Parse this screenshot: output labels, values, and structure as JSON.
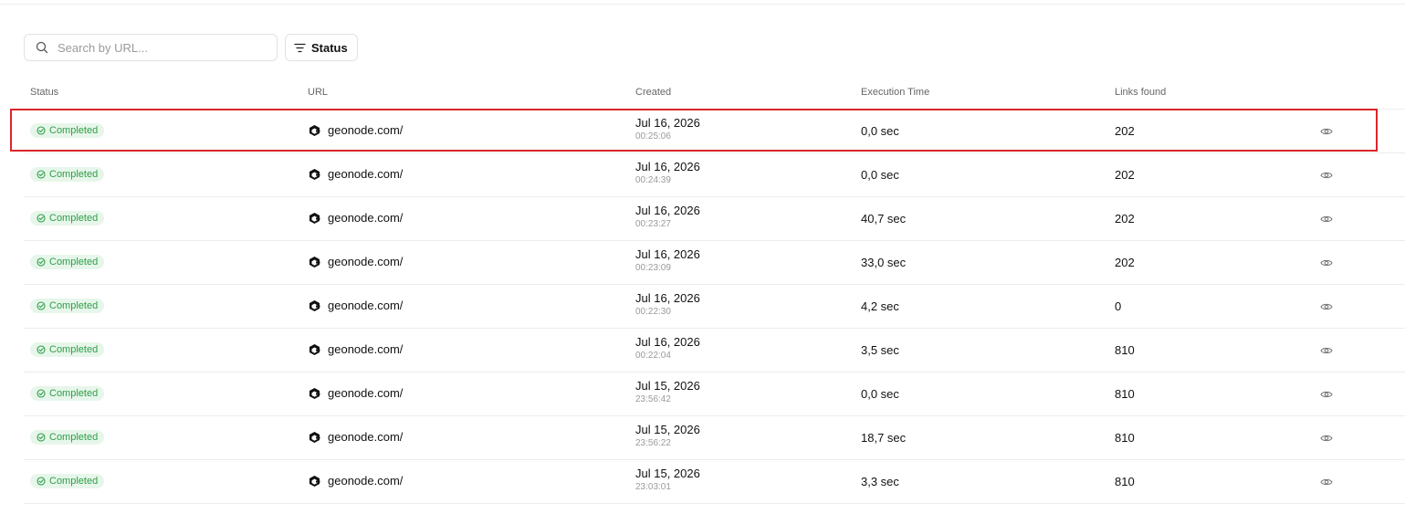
{
  "search": {
    "placeholder": "Search by URL..."
  },
  "filter": {
    "label": "Status"
  },
  "columns": {
    "status": "Status",
    "url": "URL",
    "created": "Created",
    "execution_time": "Execution Time",
    "links_found": "Links found"
  },
  "rows": [
    {
      "status": "Completed",
      "url": "geonode.com/",
      "date": "Jul 16, 2026",
      "time": "00:25:06",
      "exec": "0,0 sec",
      "links": "202"
    },
    {
      "status": "Completed",
      "url": "geonode.com/",
      "date": "Jul 16, 2026",
      "time": "00:24:39",
      "exec": "0,0 sec",
      "links": "202"
    },
    {
      "status": "Completed",
      "url": "geonode.com/",
      "date": "Jul 16, 2026",
      "time": "00:23:27",
      "exec": "40,7 sec",
      "links": "202"
    },
    {
      "status": "Completed",
      "url": "geonode.com/",
      "date": "Jul 16, 2026",
      "time": "00:23:09",
      "exec": "33,0 sec",
      "links": "202"
    },
    {
      "status": "Completed",
      "url": "geonode.com/",
      "date": "Jul 16, 2026",
      "time": "00:22:30",
      "exec": "4,2 sec",
      "links": "0"
    },
    {
      "status": "Completed",
      "url": "geonode.com/",
      "date": "Jul 16, 2026",
      "time": "00:22:04",
      "exec": "3,5 sec",
      "links": "810"
    },
    {
      "status": "Completed",
      "url": "geonode.com/",
      "date": "Jul 15, 2026",
      "time": "23:56:42",
      "exec": "0,0 sec",
      "links": "810"
    },
    {
      "status": "Completed",
      "url": "geonode.com/",
      "date": "Jul 15, 2026",
      "time": "23:56:22",
      "exec": "18,7 sec",
      "links": "810"
    },
    {
      "status": "Completed",
      "url": "geonode.com/",
      "date": "Jul 15, 2026",
      "time": "23:03:01",
      "exec": "3,3 sec",
      "links": "810"
    }
  ],
  "colors": {
    "status_completed_bg": "#e7f6ea",
    "status_completed_text": "#2f9e49",
    "highlight_border": "#d9262b"
  },
  "icons": {
    "search": "search-icon",
    "filter": "filter-icon",
    "status": "check-circle-icon",
    "site": "geonode-logo-icon",
    "view": "eye-icon"
  }
}
